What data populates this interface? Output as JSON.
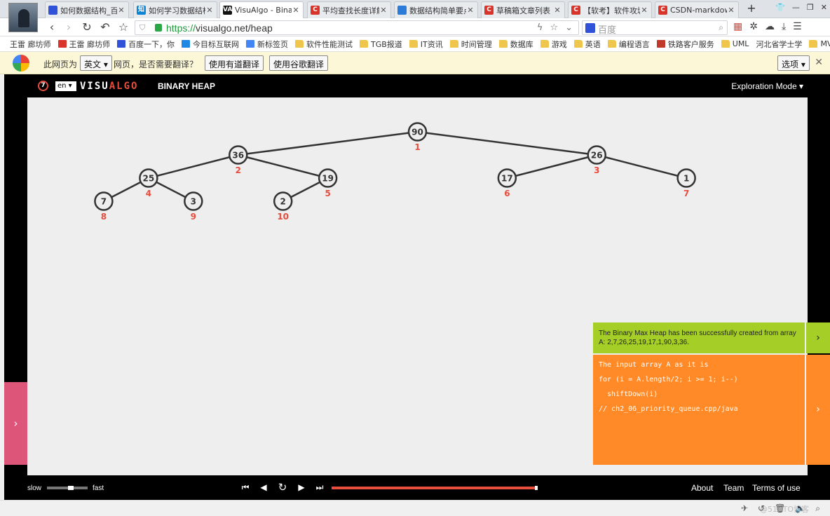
{
  "browser": {
    "tabs": [
      {
        "label": "如何数据结构_百度",
        "icon_color": "#2f52d9",
        "icon_name": "baidu-icon",
        "active": false
      },
      {
        "label": "如何学习数据结构",
        "icon_color": "#0a84d6",
        "icon_name": "zhihu-icon",
        "icon_text": "知",
        "active": false
      },
      {
        "label": "VisuAlgo - Binar",
        "icon_color": "#111111",
        "icon_name": "visualgo-icon",
        "icon_text": "VA",
        "active": true
      },
      {
        "label": "平均查找长度详解",
        "icon_color": "#d9342b",
        "icon_name": "csdn-icon",
        "icon_text": "C",
        "active": false
      },
      {
        "label": "数据结构简单要点",
        "icon_color": "#2b7bd9",
        "icon_name": "globe-icon",
        "active": false
      },
      {
        "label": "草稿箱文章列表 -",
        "icon_color": "#d9342b",
        "icon_name": "csdn-icon",
        "icon_text": "C",
        "active": false
      },
      {
        "label": "【软考】软件攻城",
        "icon_color": "#d9342b",
        "icon_name": "csdn-icon",
        "icon_text": "C",
        "active": false
      },
      {
        "label": "CSDN-markdow",
        "icon_color": "#d9342b",
        "icon_name": "csdn-icon",
        "icon_text": "C",
        "active": false
      }
    ],
    "new_tab": "+",
    "url_scheme": "https://",
    "url_rest": "visualgo.net/heap",
    "search_placeholder": "百度",
    "bookmarks": [
      {
        "label": "王雷 廊坊师",
        "kind": "page"
      },
      {
        "label": "王雷 廊坊师",
        "kind": "csdn"
      },
      {
        "label": "百度一下，你",
        "kind": "baidu"
      },
      {
        "label": "今目标互联网",
        "kind": "jin"
      },
      {
        "label": "新标签页",
        "kind": "google"
      },
      {
        "label": "软件性能测试",
        "kind": "folder"
      },
      {
        "label": "TGB报道",
        "kind": "folder"
      },
      {
        "label": "IT资讯",
        "kind": "folder"
      },
      {
        "label": "时间管理",
        "kind": "folder"
      },
      {
        "label": "数据库",
        "kind": "folder"
      },
      {
        "label": "游戏",
        "kind": "folder"
      },
      {
        "label": "英语",
        "kind": "folder"
      },
      {
        "label": "编程语言",
        "kind": "folder"
      },
      {
        "label": "铁路客户服务",
        "kind": "rail"
      },
      {
        "label": "UML",
        "kind": "folder"
      },
      {
        "label": "河北省学士学",
        "kind": "page"
      },
      {
        "label": "MV",
        "kind": "folder"
      }
    ],
    "bookmarks_more": "»",
    "translate_bar": {
      "prefix": "此网页为",
      "language": "英文",
      "question": "网页，是否需要翻译？",
      "youdao_button": "使用有道翻译",
      "google_button": "使用谷歌翻译",
      "options": "选项"
    }
  },
  "app": {
    "version_badge": "7",
    "language": "en",
    "logo_visu": "VISU",
    "logo_algo": "ALGO",
    "title": "BINARY HEAP",
    "mode": "Exploration Mode",
    "status_message": "The Binary Max Heap has been successfully created from array A: 2,7,26,25,19,17,1,90,3,36.",
    "code_lines": [
      "The input array A as it is",
      "for (i = A.length/2; i >= 1; i--)",
      "  shiftDown(i)",
      "// ch2_06_priority_queue.cpp/java"
    ],
    "speed_slow": "slow",
    "speed_fast": "fast",
    "speed_level": 0.6,
    "progress": 1.0,
    "footer_links": [
      "About",
      "Team",
      "Terms of use"
    ],
    "heap": [
      {
        "index": 1,
        "value": 90
      },
      {
        "index": 2,
        "value": 36
      },
      {
        "index": 3,
        "value": 26
      },
      {
        "index": 4,
        "value": 25
      },
      {
        "index": 5,
        "value": 19
      },
      {
        "index": 6,
        "value": 17
      },
      {
        "index": 7,
        "value": 1
      },
      {
        "index": 8,
        "value": 7
      },
      {
        "index": 9,
        "value": 3
      },
      {
        "index": 10,
        "value": 2
      }
    ]
  },
  "colors": {
    "accent_red": "#e74c3c",
    "status_green": "#a5cf26",
    "code_orange": "#ff8a27",
    "left_panel_pink": "#dd5679"
  },
  "watermark": "@51CTO博客"
}
